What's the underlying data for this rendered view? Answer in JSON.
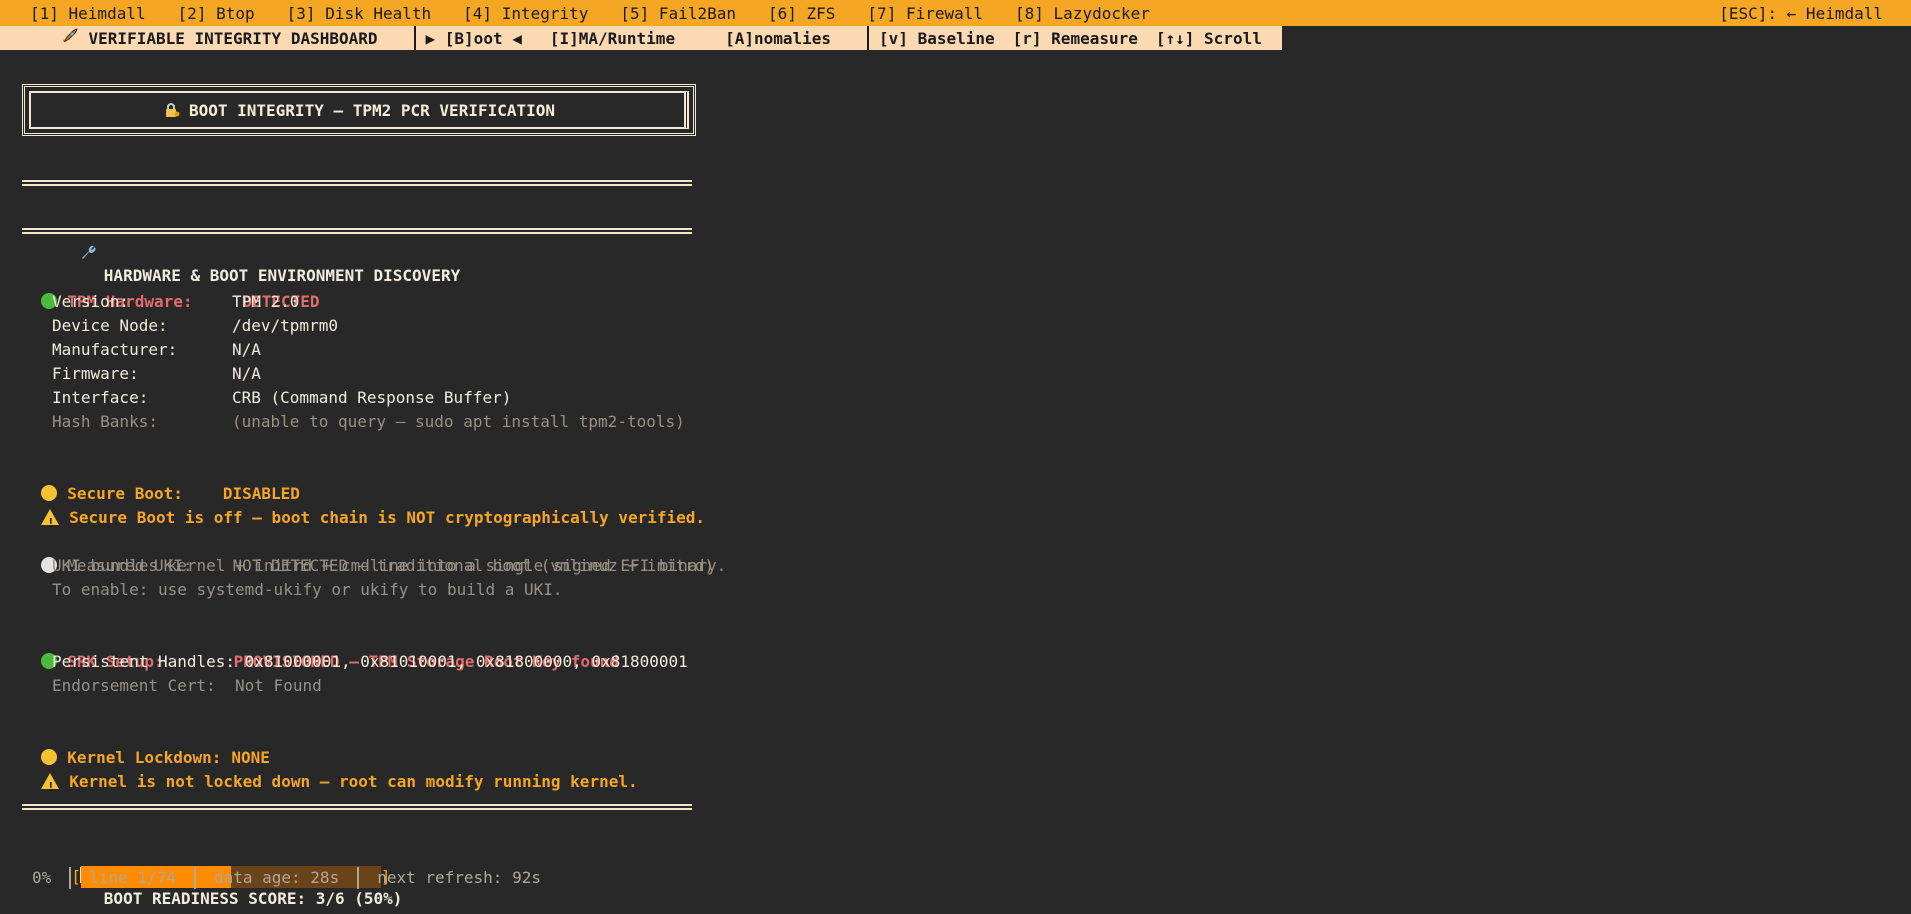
{
  "topbar": {
    "tabs": [
      "[1] Heimdall",
      "[2] Btop",
      "[3] Disk Health",
      "[4] Integrity",
      "[5] Fail2Ban",
      "[6] ZFS",
      "[7] Firewall",
      "[8] Lazydocker"
    ],
    "esc": "[ESC]: ← Heimdall"
  },
  "subbar": {
    "title": "VERIFIABLE INTEGRITY DASHBOARD",
    "boot": "▶ [B]oot ◀",
    "ima": "[I]MA/Runtime",
    "anomalies": "[A]nomalies",
    "baseline": "[v] Baseline",
    "remeasure": "[r] Remeasure",
    "scroll": "[↑↓] Scroll"
  },
  "title_box": "BOOT INTEGRITY — TPM2 PCR VERIFICATION",
  "section": "HARDWARE & BOOT ENVIRONMENT DISCOVERY",
  "tpm": {
    "label": "TPM Hardware:",
    "status": "DETECTED",
    "rows": [
      {
        "k": "Version:",
        "v": "TPM 2.0"
      },
      {
        "k": "Device Node:",
        "v": "/dev/tpmrm0"
      },
      {
        "k": "Manufacturer:",
        "v": "N/A"
      },
      {
        "k": "Firmware:",
        "v": "N/A"
      },
      {
        "k": "Interface:",
        "v": "CRB (Command Response Buffer)"
      }
    ],
    "hash_label": "Hash Banks:",
    "hash_value": "(unable to query — sudo apt install tpm2-tools)"
  },
  "secure_boot": {
    "label": "Secure Boot:",
    "status": "DISABLED",
    "warning": "Secure Boot is off — boot chain is NOT cryptographically verified."
  },
  "uki": {
    "label": "Measured UKI:",
    "status": "NOT DETECTED — traditional boot (vmlinuz + initrd)",
    "line1": "UKI bundles kernel + initrd + cmdline into a single signed EFI binary.",
    "line2": "To enable: use systemd-ukify or ukify to build a UKI."
  },
  "srk": {
    "label": "SRK Setup:",
    "status": "PROVISIONED — TPM Storage Root Key found",
    "handles": "Persistent Handles: 0x81000001, 0x81010001, 0x81800000, 0x81800001",
    "endorsement": "Endorsement Cert:  Not Found"
  },
  "lockdown": {
    "label": "Kernel Lockdown:",
    "status": "NONE",
    "warning": "Kernel is not locked down — root can modify running kernel."
  },
  "score": {
    "text": "BOOT READINESS SCORE: 3/6 (50%)",
    "fraction": 0.5
  },
  "status": {
    "percent": "0%",
    "line": "line 1/74",
    "age": "data age: 28s",
    "refresh": "next refresh: 92s"
  },
  "colors": {
    "accent": "#f5a623",
    "detected": "#e06c6c",
    "warning": "#f5a623",
    "progress_fill": "#ff8c00"
  }
}
